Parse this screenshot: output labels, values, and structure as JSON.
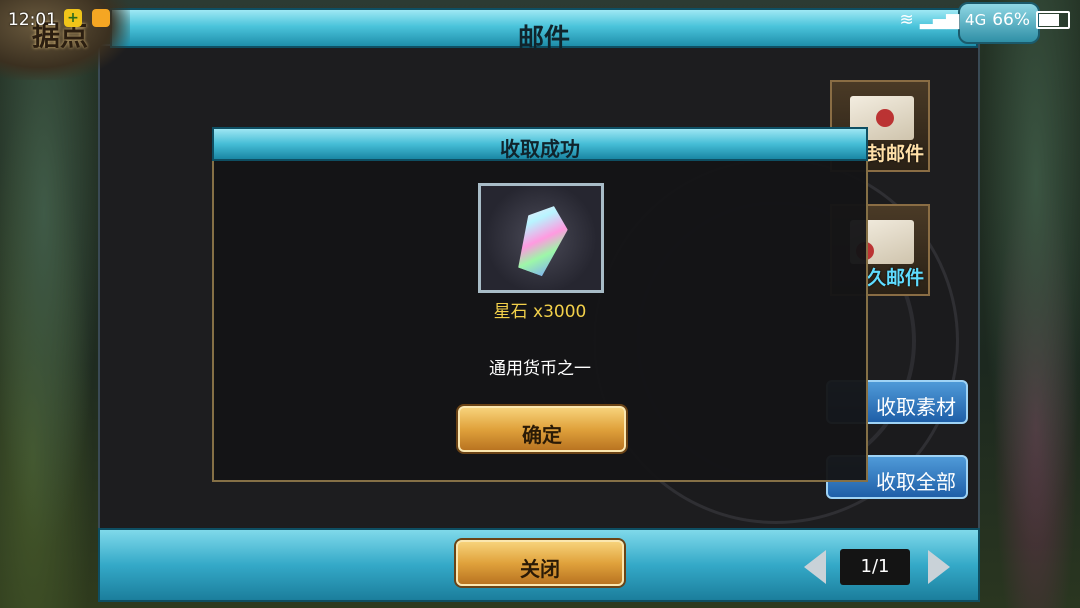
{
  "status_bar": {
    "time": "12:01",
    "network": "4G",
    "battery": "66%",
    "battery_level": 0.66
  },
  "header": {
    "title": "邮件",
    "corner_label": "据点"
  },
  "sidebar": {
    "tabs": [
      {
        "label": "封邮件",
        "icon": "envelope-icon"
      },
      {
        "label": "久邮件",
        "icon": "letters-icon"
      }
    ],
    "buttons": [
      {
        "label": "收取素材"
      },
      {
        "label": "收取全部"
      }
    ]
  },
  "footer": {
    "close_label": "关闭",
    "page": "1/1"
  },
  "dialog": {
    "title": "收取成功",
    "item_name": "星石 x3000",
    "item_icon": "star-stone-gem-icon",
    "item_description": "通用货币之一",
    "confirm_label": "确定"
  },
  "colors": {
    "accent_cyan": "#45bdd6",
    "gold": "#e0a23c",
    "item_name": "#f2d04a",
    "panel": "#1d1d1f"
  }
}
